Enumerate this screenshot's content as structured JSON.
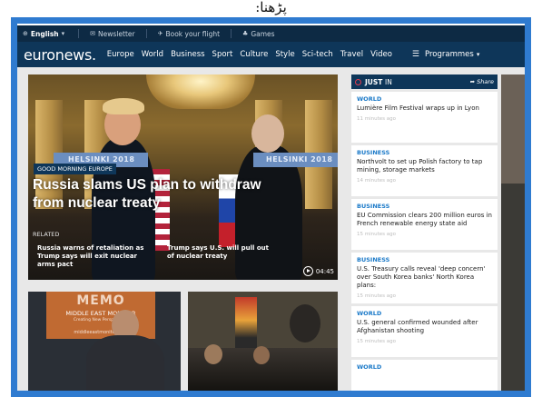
{
  "caption": "پڑھنا:",
  "util_bar": {
    "language": "English",
    "newsletter": "Newsletter",
    "book_flight": "Book your flight",
    "games": "Games"
  },
  "nav": {
    "logo_text": "euronews.",
    "items": [
      "Europe",
      "World",
      "Business",
      "Sport",
      "Culture",
      "Style",
      "Sci-tech",
      "Travel",
      "Video"
    ],
    "programmes": "Programmes"
  },
  "hero": {
    "banner_left": "HELSINKI 2018",
    "banner_right": "HELSINKI 2018",
    "tag": "GOOD MORNING EUROPE",
    "title": "Russia slams US plan to withdraw from nuclear treaty",
    "related_label": "RELATED",
    "related": [
      "Russia warns of retaliation as Trump says will exit nuclear arms pact",
      "Trump says U.S. will pull out of nuclear treaty"
    ],
    "duration": "04:45"
  },
  "just_in": {
    "title_bold": "JUST",
    "title_rest": "IN",
    "share": "Share",
    "items": [
      {
        "category": "WORLD",
        "text": "Lumière Film Festival wraps up in Lyon",
        "time": "11 minutes ago"
      },
      {
        "category": "BUSINESS",
        "text": "Northvolt to set up Polish factory to tap mining, storage markets",
        "time": "14 minutes ago"
      },
      {
        "category": "BUSINESS",
        "text": "EU Commission clears 200 million euros in French renewable energy state aid",
        "time": "15 minutes ago"
      },
      {
        "category": "BUSINESS",
        "text": "U.S. Treasury calls reveal 'deep concern' over South Korea banks' North Korea plans:",
        "time": "15 minutes ago"
      },
      {
        "category": "WORLD",
        "text": "U.S. general confirmed wounded after Afghanistan shooting",
        "time": "15 minutes ago"
      },
      {
        "category": "WORLD",
        "text": "",
        "time": ""
      }
    ]
  },
  "thumb_a": {
    "logo": "MEMO",
    "subtitle": "MIDDLE EAST MONITOR",
    "small": "Creating New Perspectives",
    "url": "middleeastmonitor.com"
  },
  "colors": {
    "frame": "#2f7bd0",
    "util_bar": "#0d2a44",
    "nav_bar": "#0e3659",
    "category": "#1a79c8",
    "just_in_accent": "#e63a4e"
  }
}
